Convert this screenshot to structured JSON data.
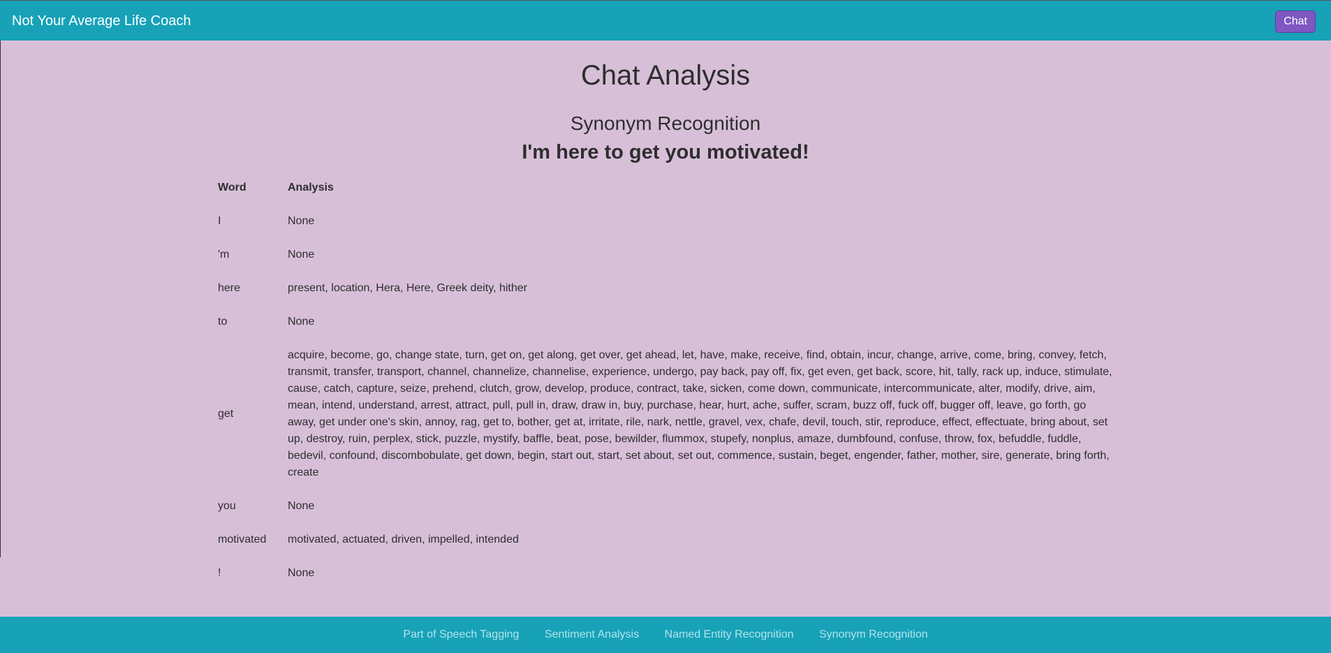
{
  "navbar": {
    "brand": "Not Your Average Life Coach",
    "chat_button": "Chat"
  },
  "main": {
    "title": "Chat Analysis",
    "section_title": "Synonym Recognition",
    "message": "I'm here to get you motivated!"
  },
  "table": {
    "headers": [
      "Word",
      "Analysis"
    ],
    "rows": [
      {
        "word": "I",
        "analysis": "None"
      },
      {
        "word": "'m",
        "analysis": "None"
      },
      {
        "word": "here",
        "analysis": "present, location, Hera, Here, Greek deity, hither"
      },
      {
        "word": "to",
        "analysis": "None"
      },
      {
        "word": "get",
        "analysis": "acquire, become, go, change state, turn, get on, get along, get over, get ahead, let, have, make, receive, find, obtain, incur, change, arrive, come, bring, convey, fetch, transmit, transfer, transport, channel, channelize, channelise, experience, undergo, pay back, pay off, fix, get even, get back, score, hit, tally, rack up, induce, stimulate, cause, catch, capture, seize, prehend, clutch, grow, develop, produce, contract, take, sicken, come down, communicate, intercommunicate, alter, modify, drive, aim, mean, intend, understand, arrest, attract, pull, pull in, draw, draw in, buy, purchase, hear, hurt, ache, suffer, scram, buzz off, fuck off, bugger off, leave, go forth, go away, get under one's skin, annoy, rag, get to, bother, get at, irritate, rile, nark, nettle, gravel, vex, chafe, devil, touch, stir, reproduce, effect, effectuate, bring about, set up, destroy, ruin, perplex, stick, puzzle, mystify, baffle, beat, pose, bewilder, flummox, stupefy, nonplus, amaze, dumbfound, confuse, throw, fox, befuddle, fuddle, bedevil, confound, discombobulate, get down, begin, start out, start, set about, set out, commence, sustain, beget, engender, father, mother, sire, generate, bring forth, create"
      },
      {
        "word": "you",
        "analysis": "None"
      },
      {
        "word": "motivated",
        "analysis": "motivated, actuated, driven, impelled, intended"
      },
      {
        "word": "!",
        "analysis": "None"
      }
    ]
  },
  "footer": {
    "links": [
      "Part of Speech Tagging",
      "Sentiment Analysis",
      "Named Entity Recognition",
      "Synonym Recognition"
    ]
  },
  "colors": {
    "navbar": "#17a2b8",
    "background": "#d8bfd8",
    "chat_button": "#7e57c2",
    "footer_link": "#b2e4ec"
  }
}
